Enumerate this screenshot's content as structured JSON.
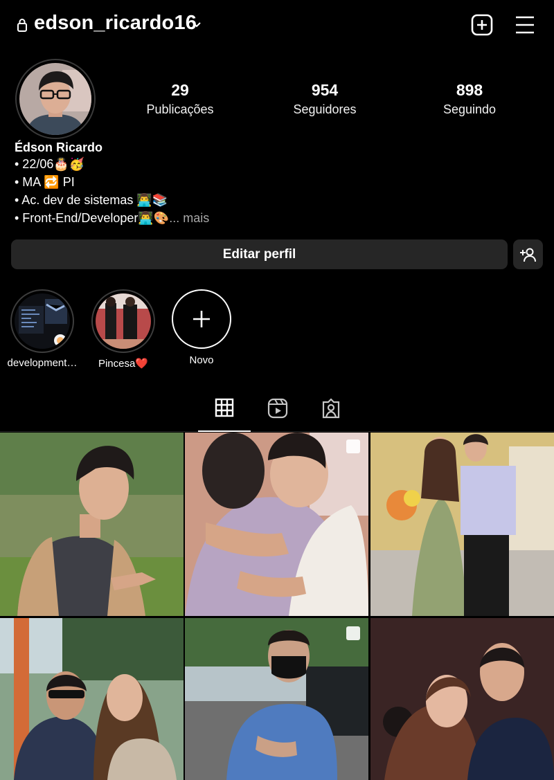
{
  "header": {
    "username": "edson_ricardo16",
    "icons": [
      "lock-icon",
      "chevron-down-icon",
      "plus-square-icon",
      "hamburger-menu-icon"
    ]
  },
  "stats": {
    "posts_value": "29",
    "posts_label": "Publicações",
    "followers_value": "954",
    "followers_label": "Seguidores",
    "following_value": "898",
    "following_label": "Seguindo"
  },
  "bio": {
    "name": "Édson Ricardo",
    "line1": "• 22/06🎂🥳",
    "line2": "• MA 🔁 PI",
    "line3": "• Ac. dev de sistemas 👨‍💻📚",
    "line4": "• Front-End/Developer👨‍💻🎨",
    "more": "... mais"
  },
  "actions": {
    "edit_profile": "Editar perfil"
  },
  "highlights": [
    {
      "label": "development…"
    },
    {
      "label": "Pincesa❤️"
    },
    {
      "label": "Novo"
    }
  ],
  "tabs": [
    "grid-icon",
    "reels-icon",
    "tagged-icon"
  ],
  "colors": {
    "background": "#000000",
    "button": "#262626",
    "muted_text": "#a8a8a8"
  }
}
